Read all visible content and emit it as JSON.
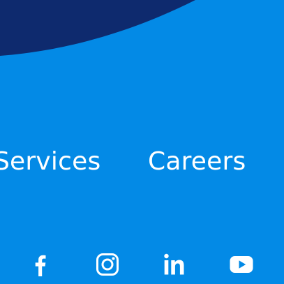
{
  "colors": {
    "background": "#038ae6",
    "wave": "#0e2a6e",
    "text": "#ffffff"
  },
  "nav": {
    "services_label": "Services",
    "careers_label": "Careers"
  },
  "social": [
    {
      "icon": "facebook-icon"
    },
    {
      "icon": "instagram-icon"
    },
    {
      "icon": "linkedin-icon"
    },
    {
      "icon": "youtube-icon"
    }
  ]
}
